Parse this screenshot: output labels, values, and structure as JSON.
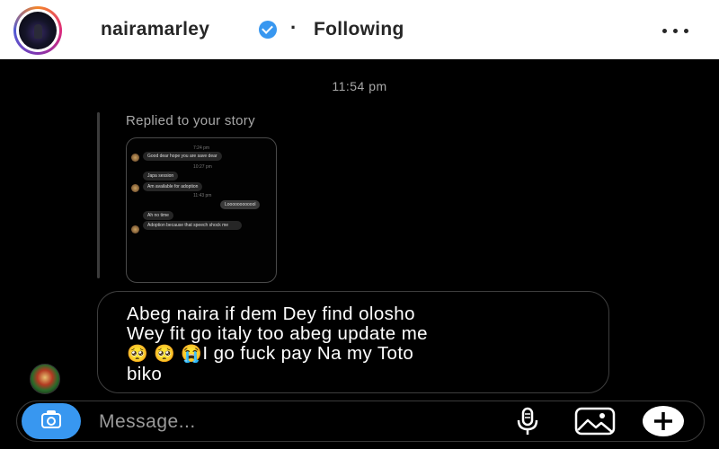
{
  "header": {
    "username": "nairamarley",
    "separator": "·",
    "follow_status": "Following"
  },
  "chat": {
    "timestamp": "11:54 pm",
    "reply_label": "Replied to your story",
    "story_preview": {
      "time_top": "7:24 pm",
      "msg1": "Good dear hope you are save dear",
      "time2": "10:27 pm",
      "msg2": "Japa session",
      "msg3": "Am available for adoption",
      "time3": "11:43 pm",
      "msg4": "Loooooooooool",
      "msg5": "Ah no time",
      "msg6": "Adoption because that speech shock me"
    },
    "message": {
      "line1": "Abeg naira  if dem Dey find olosho",
      "line2": "Wey fit go italy too abeg update me",
      "emoji1": "🥺",
      "emoji2": "🥺",
      "emoji3": "😭",
      "line3_text": "I go fuck pay Na my Toto",
      "line4": "biko"
    }
  },
  "composer": {
    "placeholder": "Message..."
  },
  "colors": {
    "background": "#000000",
    "header_bg": "#ffffff",
    "accent_blue": "#3897f0",
    "muted_text": "#a8a8a8"
  },
  "icons": [
    "verified-badge-icon",
    "more-options-icon",
    "camera-icon",
    "microphone-icon",
    "gallery-icon",
    "plus-icon"
  ]
}
